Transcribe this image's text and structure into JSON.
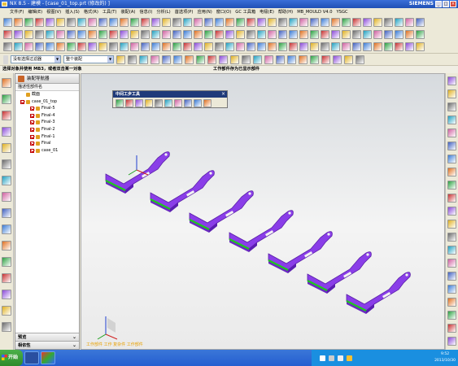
{
  "window": {
    "title": "NX 8.5 - 建模 - [case_01_top.prt (修改的) ]",
    "brand": "SIEMENS",
    "minimize": "_",
    "maximize": "□",
    "close": "×"
  },
  "menu": [
    "文件(F)",
    "编辑(E)",
    "视图(V)",
    "插入(S)",
    "格式(R)",
    "工具(T)",
    "装配(A)",
    "信息(I)",
    "分析(L)",
    "首选项(P)",
    "应用(N)",
    "窗口(O)",
    "GC 工具箱",
    "电极(E)",
    "帮助(H)",
    "MB_MOULD V4.0",
    "YSGC"
  ],
  "selection_bar": {
    "filter_value": "没有选择过滤器",
    "scope_value": "整个装配"
  },
  "cue_line": {
    "left": "选择对象并使用 MB3，或者双击某一对象",
    "center": "工作部件存为已显示部件"
  },
  "navigator": {
    "title": "装配导航器",
    "column_header": "描述性部件名",
    "nodes": [
      {
        "label": "截面",
        "level": 0,
        "checkbox": false
      },
      {
        "label": "case_01_top",
        "level": 0,
        "checkbox": true
      },
      {
        "label": "Final-5",
        "level": 1,
        "checkbox": true
      },
      {
        "label": "Final-4",
        "level": 1,
        "checkbox": true
      },
      {
        "label": "Final-3",
        "level": 1,
        "checkbox": true
      },
      {
        "label": "Final-2",
        "level": 1,
        "checkbox": true
      },
      {
        "label": "Final-1",
        "level": 1,
        "checkbox": true
      },
      {
        "label": "Final",
        "level": 1,
        "checkbox": true
      },
      {
        "label": "case_01",
        "level": 1,
        "checkbox": true
      }
    ],
    "footer": [
      "预览",
      "相依性"
    ]
  },
  "floating_toolbar": {
    "title": "中间工步工具",
    "close": "×"
  },
  "viewport": {
    "status_message": "工作部件 工作 复杂件 工作部件",
    "part_color": "#8a3ee8",
    "edge_color": "#1ec81e"
  },
  "taskbar": {
    "start_label": "开始",
    "clock_time": "9:52",
    "clock_date": "2013/10/30"
  },
  "colors": {
    "title_bar": "#2a5fd0",
    "taskbar": "#245ed0",
    "tray": "#1a8fe0"
  }
}
